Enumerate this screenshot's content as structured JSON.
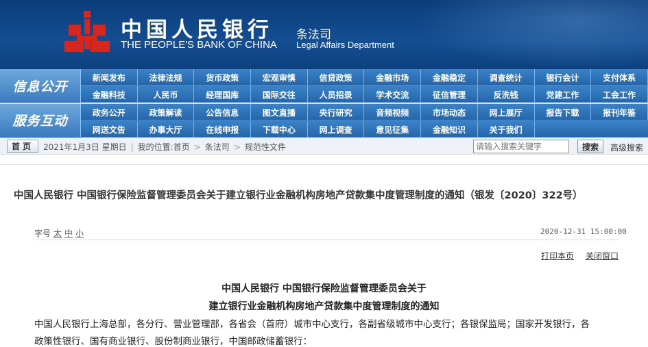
{
  "header": {
    "bank_name_cn": "中国人民银行",
    "bank_name_en": "THE PEOPLE'S BANK OF CHINA",
    "dept_cn": "条法司",
    "dept_en": "Legal Affairs Department",
    "colors": {
      "header_bg": "#0b3c7b",
      "logo_red": "#d7261b"
    }
  },
  "nav": {
    "label1": "信息公开",
    "label2": "服务互动",
    "row1": [
      "新闻发布",
      "法律法规",
      "货币政策",
      "宏观审慎",
      "信贷政策",
      "金融市场",
      "金融稳定",
      "调查统计",
      "银行会计",
      "支付体系"
    ],
    "row2": [
      "金融科技",
      "人民币",
      "经理国库",
      "国际交往",
      "人员招录",
      "学术交流",
      "征信管理",
      "反洗钱",
      "党建工作",
      "工会工作"
    ],
    "row3": [
      "政务公开",
      "政策解读",
      "公告信息",
      "图文直播",
      "央行研究",
      "音频视频",
      "市场动态",
      "网上展厅",
      "报告下载",
      "报刊年鉴"
    ],
    "row4": [
      "网送文告",
      "办事大厅",
      "在线申报",
      "下载中心",
      "网上调查",
      "意见征集",
      "金融知识",
      "关于我们"
    ]
  },
  "crumbbar": {
    "home_label": "首页",
    "date": "2021年1月3日 星期日",
    "location_prefix": "我的位置:",
    "crumbs": [
      "首页",
      "条法司",
      "规范性文件"
    ],
    "search_placeholder": "请输入搜索关键字",
    "search_button": "搜索",
    "advanced_search": "高级搜索"
  },
  "article": {
    "title": "中国人民银行 中国银行保险监督管理委员会关于建立银行业金融机构房地产贷款集中度管理制度的通知（银发〔2020〕322号）",
    "font_size_label": "字号",
    "font_sizes": [
      "太",
      "中",
      "小"
    ],
    "datetime": "2020-12-31 15:00:00",
    "print": "打印本页",
    "close": "关闭窗口",
    "heading1": "中国人民银行 中国银行保险监督管理委员会关于",
    "heading2": "建立银行业金融机构房地产贷款集中度管理制度的通知",
    "body_line1": "中国人民银行上海总部，各分行、营业管理部，各省会（首府）城市中心支行，各副省级城市中心支行；各银保监局；国家开发银行，各",
    "body_line2": "政策性银行、国有商业银行、股份制商业银行，中国邮政储蓄银行："
  }
}
